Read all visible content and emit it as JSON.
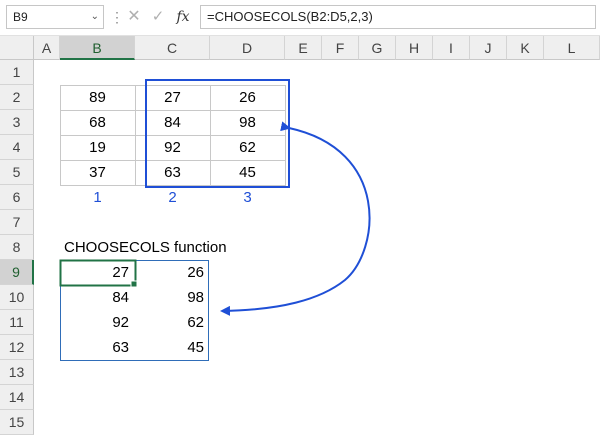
{
  "formula_bar": {
    "name_box": "B9",
    "dots": "⋮",
    "cancel_icon": "✕",
    "enter_icon": "✓",
    "fx_label": "fx",
    "formula": "=CHOOSECOLS(B2:D5,2,3)"
  },
  "columns": [
    "A",
    "B",
    "C",
    "D",
    "E",
    "F",
    "G",
    "H",
    "I",
    "J",
    "K",
    "L"
  ],
  "rows": [
    "1",
    "2",
    "3",
    "4",
    "5",
    "6",
    "7",
    "8",
    "9",
    "10",
    "11",
    "12",
    "13",
    "14",
    "15"
  ],
  "source_table": {
    "rows": [
      [
        "89",
        "27",
        "26"
      ],
      [
        "68",
        "84",
        "98"
      ],
      [
        "19",
        "92",
        "62"
      ],
      [
        "37",
        "63",
        "45"
      ]
    ]
  },
  "column_numbers": [
    "1",
    "2",
    "3"
  ],
  "result_label": "CHOOSECOLS function",
  "result_table": {
    "rows": [
      [
        "27",
        "26"
      ],
      [
        "84",
        "98"
      ],
      [
        "92",
        "62"
      ],
      [
        "63",
        "45"
      ]
    ]
  },
  "colors": {
    "highlight_blue": "#1f4fd6",
    "selection_green": "#217346"
  }
}
